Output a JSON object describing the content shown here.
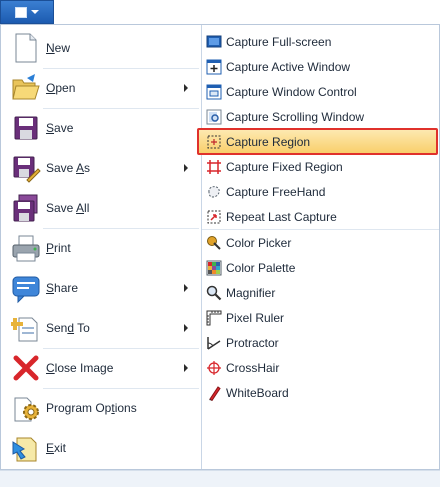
{
  "app_button": {
    "label": ""
  },
  "left_menu": {
    "items": [
      {
        "name": "new",
        "label": "New",
        "underline": "N",
        "rest": "ew",
        "icon": "new-document-icon",
        "has_submenu": false
      },
      {
        "name": "open",
        "label": "Open",
        "underline": "O",
        "rest": "pen",
        "icon": "folder-open-icon",
        "has_submenu": true
      },
      {
        "name": "save",
        "label": "Save",
        "underline": "S",
        "rest": "ave",
        "icon": "floppy-disk-icon",
        "has_submenu": false
      },
      {
        "name": "save-as",
        "label": "Save As",
        "pre": "Save ",
        "underline": "A",
        "rest": "s",
        "icon": "save-as-icon",
        "has_submenu": true
      },
      {
        "name": "save-all",
        "label": "Save All",
        "pre": "Save ",
        "underline": "A",
        "rest": "ll",
        "icon": "save-all-icon",
        "has_submenu": false
      },
      {
        "name": "print",
        "label": "Print",
        "underline": "P",
        "rest": "rint",
        "icon": "printer-icon",
        "has_submenu": false
      },
      {
        "name": "share",
        "label": "Share",
        "underline": "S",
        "rest": "hare",
        "icon": "share-icon",
        "has_submenu": true
      },
      {
        "name": "send-to",
        "label": "Send To",
        "pre": "Sen",
        "underline": "d",
        "rest": " To",
        "icon": "send-to-icon",
        "has_submenu": true
      },
      {
        "name": "close-image",
        "label": "Close Image",
        "underline": "C",
        "rest": "lose Image",
        "icon": "close-x-icon",
        "has_submenu": true
      },
      {
        "name": "program-options",
        "label": "Program Options",
        "pre": "Program Op",
        "underline": "t",
        "rest": "ions",
        "icon": "gear-options-icon",
        "has_submenu": false
      },
      {
        "name": "exit",
        "label": "Exit",
        "underline": "E",
        "rest": "xit",
        "icon": "exit-icon",
        "has_submenu": false
      }
    ]
  },
  "right_menu": {
    "items": [
      {
        "name": "capture-full-screen",
        "label": "Capture Full-screen",
        "icon": "monitor-icon"
      },
      {
        "name": "capture-active-window",
        "label": "Capture Active Window",
        "icon": "active-window-icon"
      },
      {
        "name": "capture-window-control",
        "label": "Capture Window Control",
        "icon": "window-control-icon"
      },
      {
        "name": "capture-scrolling-window",
        "label": "Capture Scrolling Window",
        "icon": "scrolling-window-icon"
      },
      {
        "name": "capture-region",
        "label": "Capture Region",
        "icon": "region-icon",
        "highlighted": true
      },
      {
        "name": "capture-fixed-region",
        "label": "Capture Fixed Region",
        "icon": "fixed-region-icon"
      },
      {
        "name": "capture-freehand",
        "label": "Capture FreeHand",
        "icon": "freehand-icon"
      },
      {
        "name": "repeat-last-capture",
        "label": "Repeat Last Capture",
        "icon": "repeat-capture-icon"
      },
      {
        "name": "color-picker",
        "label": "Color Picker",
        "icon": "color-picker-icon"
      },
      {
        "name": "color-palette",
        "label": "Color Palette",
        "icon": "color-palette-icon"
      },
      {
        "name": "magnifier",
        "label": "Magnifier",
        "icon": "magnifier-icon"
      },
      {
        "name": "pixel-ruler",
        "label": "Pixel Ruler",
        "icon": "pixel-ruler-icon"
      },
      {
        "name": "protractor",
        "label": "Protractor",
        "icon": "protractor-icon"
      },
      {
        "name": "crosshair",
        "label": "CrossHair",
        "icon": "crosshair-icon"
      },
      {
        "name": "whiteboard",
        "label": "WhiteBoard",
        "icon": "whiteboard-icon"
      }
    ]
  },
  "colors": {
    "app_button": "#1c5bb0",
    "highlight_fill": "#f9cf6b",
    "highlight_border": "#e0312b",
    "divider": "#c9d6e6"
  }
}
